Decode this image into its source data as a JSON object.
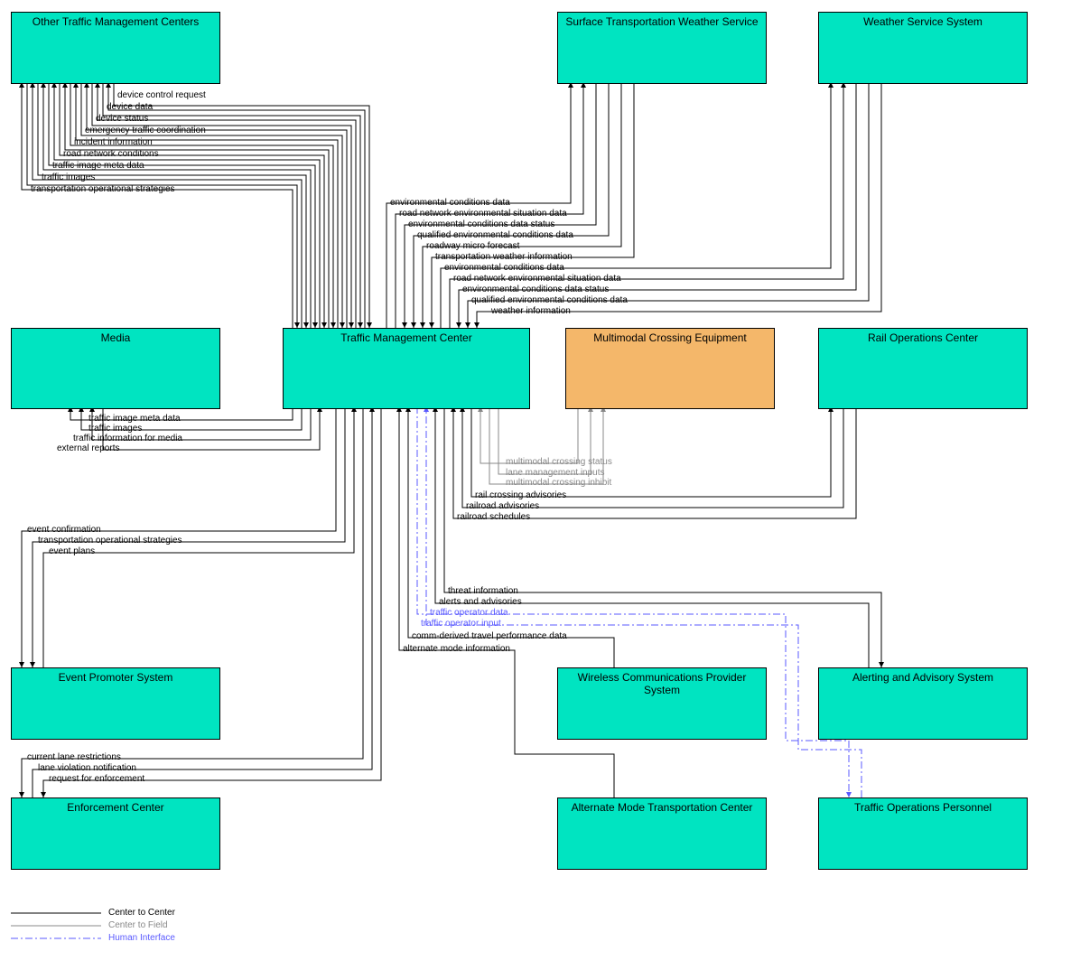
{
  "boxes": {
    "otmc": "Other Traffic Management Centers",
    "stws": "Surface Transportation Weather Service",
    "wss": "Weather Service System",
    "media": "Media",
    "tmc": "Traffic Management Center",
    "mce": "Multimodal Crossing Equipment",
    "roc": "Rail Operations Center",
    "eps": "Event Promoter System",
    "wcps": "Wireless Communications Provider System",
    "aas": "Alerting and Advisory System",
    "ec": "Enforcement Center",
    "amtc": "Alternate Mode Transportation Center",
    "top": "Traffic Operations Personnel"
  },
  "flows": {
    "otmc": {
      "device_control_request": "device control request",
      "device_data": "device data",
      "device_status": "device status",
      "emergency_traffic_coord": "emergency traffic coordination",
      "incident_information": "incident information",
      "road_network_conditions": "road network conditions",
      "traffic_image_meta": "traffic image meta data",
      "traffic_images": "traffic images",
      "trans_op_strategies": "transportation operational strategies"
    },
    "stws": {
      "env_conditions_data": "environmental conditions data",
      "rnes_data": "road network environmental situation data",
      "env_cond_data_status": "environmental conditions data status",
      "qual_env_cond_data": "qualified environmental conditions data",
      "roadway_micro_forecast": "roadway micro forecast",
      "trans_weather_info": "transportation weather information"
    },
    "wss": {
      "env_conditions_data": "environmental conditions data",
      "rnes_data": "road network environmental situation data",
      "env_cond_data_status": "environmental conditions data status",
      "qual_env_cond_data": "qualified environmental conditions data",
      "weather_information": "weather information"
    },
    "media": {
      "traffic_image_meta": "traffic image meta data",
      "traffic_images": "traffic images",
      "traffic_info_media": "traffic information for media",
      "external_reports": "external reports"
    },
    "mce": {
      "mm_crossing_inhibit": "multimodal crossing inhibit",
      "lane_mgmt_inputs": "lane management inputs",
      "mm_crossing_status": "multimodal crossing status"
    },
    "roc": {
      "rail_crossing_adv": "rail crossing advisories",
      "railroad_adv": "railroad advisories",
      "railroad_sched": "railroad schedules"
    },
    "aas": {
      "threat_info": "threat information",
      "alerts_adv": "alerts and advisories"
    },
    "top_personnel": {
      "traffic_op_data": "traffic operator data",
      "traffic_op_input": "traffic operator input"
    },
    "wcps": {
      "comm_derived": "comm-derived travel performance data"
    },
    "amtc": {
      "alt_mode_info": "alternate mode information"
    },
    "eps": {
      "event_confirmation": "event confirmation",
      "trans_op_strategies": "transportation operational strategies",
      "event_plans": "event plans"
    },
    "ec": {
      "cur_lane_restr": "current lane restrictions",
      "lane_violation_notif": "lane violation notification",
      "req_enforcement": "request for enforcement"
    }
  },
  "legend": {
    "c2c": "Center to Center",
    "c2f": "Center to Field",
    "hi": "Human Interface"
  }
}
